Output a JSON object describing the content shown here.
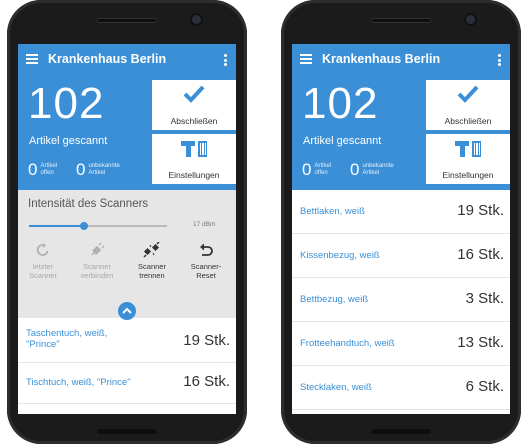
{
  "app": {
    "title": "Krankenhaus Berlin"
  },
  "stats": {
    "scanned_count": "102",
    "scanned_label": "Artikel gescannt",
    "open_count": "0",
    "open_label_1": "Artikel",
    "open_label_2": "offen",
    "unknown_count": "0",
    "unknown_label_1": "unbekannte",
    "unknown_label_2": "Artikel"
  },
  "tiles": {
    "complete_label": "Abschließen",
    "settings_label": "Einstellungen"
  },
  "scanner": {
    "title": "Intensität des Scanners",
    "intensity_value": "17 dBm",
    "intensity_level": 0.4,
    "actions": [
      {
        "line1": "letzter",
        "line2": "Scanner",
        "icon": "refresh-icon",
        "enabled": false
      },
      {
        "line1": "Scanner",
        "line2": "verbinden",
        "icon": "plug-icon",
        "enabled": false
      },
      {
        "line1": "Scanner",
        "line2": "trennen",
        "icon": "plug-disconnect-icon",
        "enabled": true
      },
      {
        "line1": "Scanner-",
        "line2": "Reset",
        "icon": "undo-icon",
        "enabled": true
      }
    ]
  },
  "left_items": [
    {
      "name_line1": "Taschentuch, weiß,",
      "name_line2": "\"Prince\"",
      "qty": "19 Stk."
    },
    {
      "name_line1": "Tischtuch, weiß, \"Prince\"",
      "name_line2": "",
      "qty": "16 Stk."
    }
  ],
  "right_items": [
    {
      "name": "Bettlaken, weiß",
      "qty": "19 Stk."
    },
    {
      "name": "Kissenbezug, weiß",
      "qty": "16 Stk."
    },
    {
      "name": "Bettbezug, weiß",
      "qty": "3 Stk."
    },
    {
      "name": "Frotteehandtuch, weiß",
      "qty": "13 Stk."
    },
    {
      "name": "Stecklaken, weiß",
      "qty": "6 Stk."
    }
  ],
  "colors": {
    "primary": "#3a8fd6",
    "panel": "#e6e6e6",
    "bezel": "#1b1b1b"
  }
}
